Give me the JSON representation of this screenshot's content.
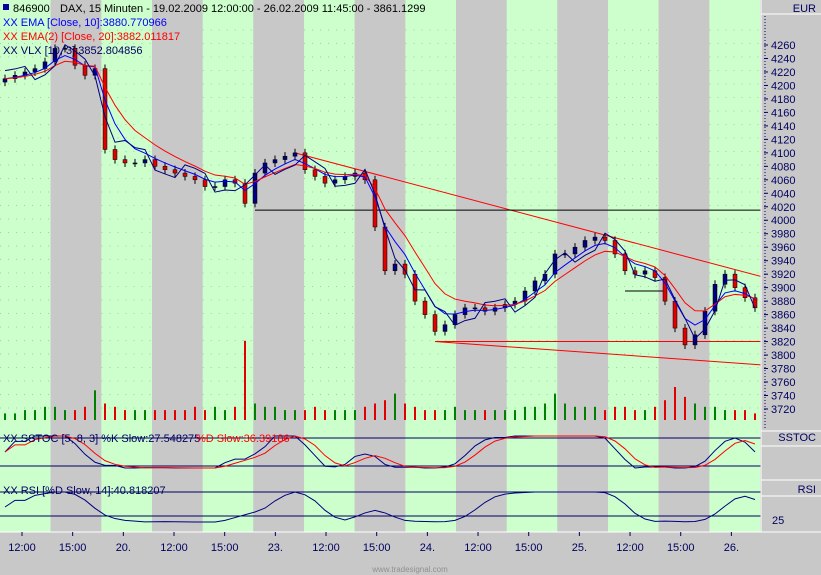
{
  "header": {
    "symbol": "846900",
    "title": "DAX, 15 Minuten - 19.02.2009 12:00:00 - 26.02.2009 11:45:00 - 3861.1299"
  },
  "legend": {
    "ema10": "XX EMA [Close, 10]:3880.770966",
    "ema20": "XX EMA(2) [Close, 20]:3882.011817",
    "vlx": "XX VLX [10, 3]:3852.804856"
  },
  "sstoc": {
    "label_k": "XX SSTOC [5, 8, 3] %K Slow:27.548275",
    "label_d": "%D Slow:36.39186",
    "axis": "SSTOC"
  },
  "rsi": {
    "label": "XX RSI [%D Slow, 14]:40.818207",
    "axis": "RSI",
    "tick": "25"
  },
  "currency": "EUR",
  "watermark": "www.tradesignal.com",
  "colors": {
    "green": "#ccffcc",
    "gray": "#c8c8c8",
    "up": "#000080",
    "down": "#e00000",
    "ema10": "#0000ff",
    "ema20": "#ff0000"
  },
  "chart_data": {
    "type": "candlestick",
    "title": "846900 DAX, 15 Minuten",
    "ylim": [
      3700,
      4300
    ],
    "yticks": [
      4260,
      4240,
      4220,
      4200,
      4180,
      4160,
      4140,
      4120,
      4100,
      4080,
      4060,
      4040,
      4020,
      4000,
      3980,
      3960,
      3940,
      3920,
      3900,
      3880,
      3860,
      3840,
      3820,
      3800,
      3780,
      3760,
      3740,
      3720
    ],
    "xticks": [
      "12:00",
      "15:00",
      "20.",
      "12:00",
      "15:00",
      "23.",
      "12:00",
      "15:00",
      "24.",
      "12:00",
      "15:00",
      "25.",
      "12:00",
      "15:00",
      "26."
    ],
    "closes": [
      4210,
      4215,
      4220,
      4225,
      4235,
      4255,
      4255,
      4230,
      4215,
      4225,
      4105,
      4090,
      4085,
      4085,
      4090,
      4080,
      4075,
      4070,
      4065,
      4060,
      4050,
      4050,
      4060,
      4055,
      4025,
      4070,
      4085,
      4090,
      4095,
      4100,
      4075,
      4065,
      4055,
      4060,
      4065,
      4070,
      4060,
      3990,
      3925,
      3935,
      3920,
      3880,
      3860,
      3835,
      3845,
      3860,
      3870,
      3870,
      3865,
      3870,
      3875,
      3880,
      3895,
      3910,
      3920,
      3950,
      3950,
      3960,
      3970,
      3975,
      3970,
      3950,
      3925,
      3920,
      3925,
      3915,
      3880,
      3840,
      3815,
      3830,
      3865,
      3905,
      3920,
      3900,
      3885,
      3870
    ],
    "volume": [
      2,
      2,
      3,
      3,
      4,
      4,
      3,
      3,
      4,
      9,
      5,
      4,
      3,
      3,
      3,
      3,
      3,
      3,
      3,
      4,
      3,
      4,
      3,
      4,
      24,
      5,
      4,
      4,
      3,
      3,
      3,
      4,
      3,
      3,
      3,
      3,
      4,
      5,
      6,
      8,
      5,
      4,
      3,
      3,
      3,
      4,
      3,
      3,
      3,
      3,
      3,
      3,
      4,
      4,
      5,
      8,
      5,
      4,
      4,
      4,
      3,
      4,
      4,
      3,
      3,
      4,
      6,
      10,
      7,
      5,
      4,
      4,
      3,
      3,
      3,
      2
    ],
    "trendlines": [
      {
        "from": [
          29,
          4100
        ],
        "to": [
          76,
          3915
        ],
        "color": "red"
      },
      {
        "from": [
          43,
          3820
        ],
        "to": [
          76,
          3785
        ],
        "color": "red"
      },
      {
        "from": [
          25,
          4015
        ],
        "to": [
          76,
          4015
        ],
        "color": "black"
      },
      {
        "from": [
          43,
          3820
        ],
        "to": [
          76,
          3820
        ],
        "color": "red"
      },
      {
        "from": [
          62,
          3895
        ],
        "to": [
          66,
          3895
        ],
        "color": "black"
      }
    ]
  }
}
